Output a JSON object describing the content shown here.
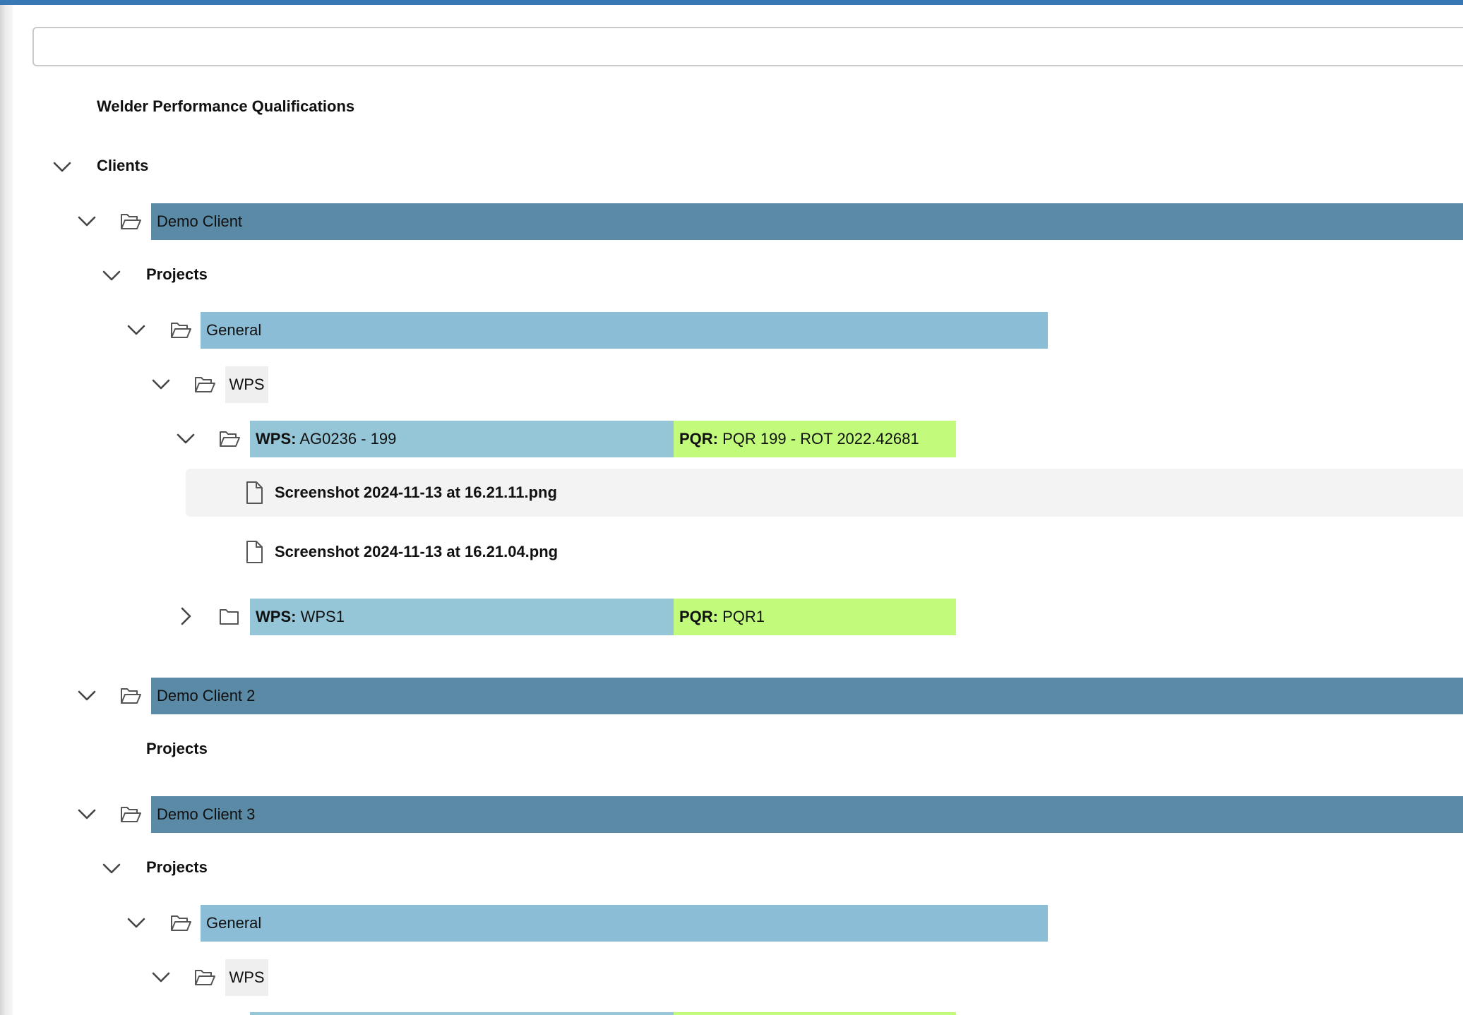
{
  "header": {
    "title": "Welder Performance Qualifications"
  },
  "search": {
    "value": ""
  },
  "tree": {
    "clients_label": "Clients",
    "projects_label": "Projects",
    "clients": [
      {
        "name": "Demo Client",
        "projects": [
          {
            "name": "General",
            "wps_folder": "WPS",
            "wps_items": [
              {
                "wps_key": "WPS:",
                "wps_value": "AG0236 - 199",
                "pqr_key": "PQR:",
                "pqr_value": "PQR 199 - ROT 2022.42681",
                "expanded": true,
                "files": [
                  "Screenshot 2024-11-13 at 16.21.11.png",
                  "Screenshot 2024-11-13 at 16.21.04.png"
                ]
              },
              {
                "wps_key": "WPS:",
                "wps_value": "WPS1",
                "pqr_key": "PQR:",
                "pqr_value": "PQR1",
                "expanded": false
              }
            ]
          }
        ]
      },
      {
        "name": "Demo Client 2",
        "projects": []
      },
      {
        "name": "Demo Client 3",
        "projects": [
          {
            "name": "General",
            "wps_folder": "WPS"
          }
        ]
      }
    ]
  },
  "colors": {
    "client_bar": "#5a8aa5",
    "project_bar": "#8cbdd6",
    "wps_bar": "#95c6d8",
    "pqr_bar": "#c2fb7c",
    "top_accent": "#3a78b5"
  },
  "icons": {
    "expanded": "chevron-down-icon",
    "collapsed": "chevron-right-icon",
    "open_folder": "folder-open-icon",
    "closed_folder": "folder-icon",
    "file": "file-icon"
  }
}
